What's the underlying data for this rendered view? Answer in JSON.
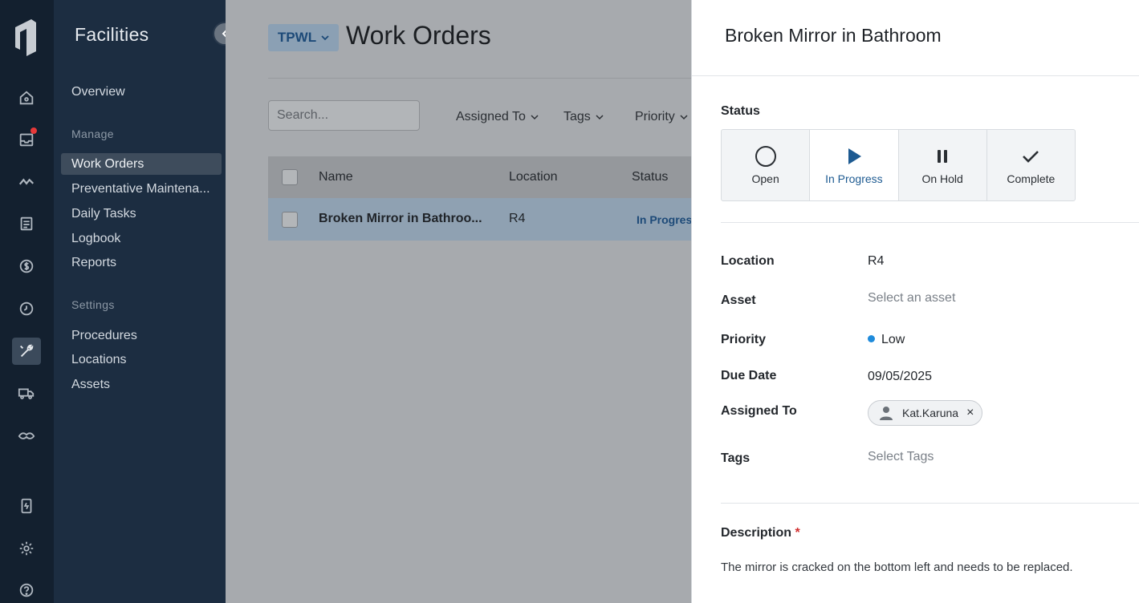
{
  "nav": {
    "title": "Facilities",
    "overview": "Overview",
    "manage_section": "Manage",
    "items": [
      {
        "label": "Work Orders"
      },
      {
        "label": "Preventative Maintena..."
      },
      {
        "label": "Daily Tasks"
      },
      {
        "label": "Logbook"
      },
      {
        "label": "Reports"
      }
    ],
    "settings_section": "Settings",
    "settings_items": [
      {
        "label": "Procedures"
      },
      {
        "label": "Locations"
      },
      {
        "label": "Assets"
      }
    ]
  },
  "rail": {
    "icons": [
      "logo-icon",
      "home-icon",
      "inbox-icon",
      "activity-icon",
      "document-icon",
      "dollar-icon",
      "clock-icon",
      "wrench-icon",
      "truck-icon",
      "handshake-icon",
      "device-icon",
      "gear-icon",
      "help-icon"
    ],
    "active": "wrench-icon",
    "notification_color": "#e63939"
  },
  "main": {
    "workspace": "TPWL",
    "title": "Work Orders",
    "search_placeholder": "Search...",
    "filters": [
      "Assigned To",
      "Tags",
      "Priority"
    ],
    "columns": [
      "Name",
      "Location",
      "Status"
    ],
    "rows": [
      {
        "name": "Broken Mirror in Bathroo...",
        "location": "R4",
        "status": "In Progress"
      }
    ]
  },
  "panel": {
    "title": "Broken Mirror in Bathroom",
    "status_label": "Status",
    "statuses": [
      {
        "label": "Open",
        "icon": "circle-icon"
      },
      {
        "label": "In Progress",
        "icon": "play-icon"
      },
      {
        "label": "On Hold",
        "icon": "pause-icon"
      },
      {
        "label": "Complete",
        "icon": "check-icon"
      }
    ],
    "current_status": "In Progress",
    "fields": {
      "location_label": "Location",
      "location_value": "R4",
      "asset_label": "Asset",
      "asset_placeholder": "Select an asset",
      "priority_label": "Priority",
      "priority_value": "Low",
      "priority_color": "#1f8bdb",
      "due_label": "Due Date",
      "due_value": "09/05/2025",
      "assigned_label": "Assigned To",
      "assigned_value": "Kat.Karuna",
      "tags_label": "Tags",
      "tags_placeholder": "Select Tags"
    },
    "description_label": "Description",
    "description_required": "*",
    "description_text": "The mirror is cracked on the bottom left and needs to be replaced."
  }
}
